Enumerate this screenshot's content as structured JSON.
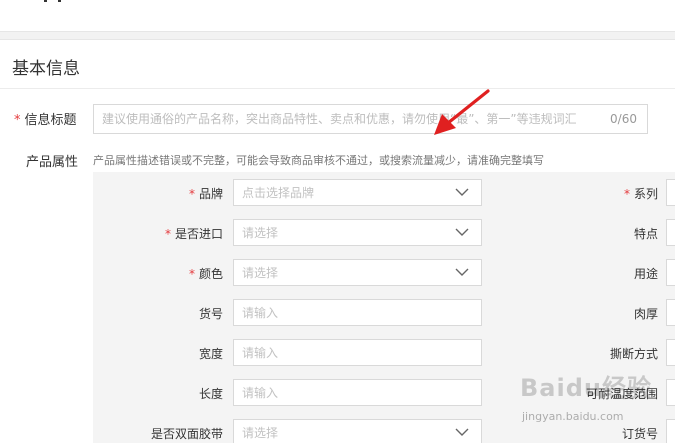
{
  "section": {
    "title": "基本信息"
  },
  "info_title": {
    "required_mark": "*",
    "label": "信息标题",
    "placeholder": "建议使用通俗的产品名称，突出商品特性、卖点和优惠，请勿使用“最”、第一”等违规词汇",
    "counter": "0/60"
  },
  "product_attributes": {
    "label": "产品属性",
    "hint": "产品属性描述错误或不完整，可能会导致商品审核不通过，或搜索流量减少，请准确完整填写",
    "left_fields": [
      {
        "label": "品牌",
        "required": true,
        "placeholder": "点击选择品牌",
        "type": "select"
      },
      {
        "label": "是否进口",
        "required": true,
        "placeholder": "请选择",
        "type": "select"
      },
      {
        "label": "颜色",
        "required": true,
        "placeholder": "请选择",
        "type": "select"
      },
      {
        "label": "货号",
        "required": false,
        "placeholder": "请输入",
        "type": "input"
      },
      {
        "label": "宽度",
        "required": false,
        "placeholder": "请输入",
        "type": "input"
      },
      {
        "label": "长度",
        "required": false,
        "placeholder": "请输入",
        "type": "input"
      },
      {
        "label": "是否双面胶带",
        "required": false,
        "placeholder": "请选择",
        "type": "select"
      }
    ],
    "right_fields": [
      {
        "label": "系列",
        "required": true
      },
      {
        "label": "特点",
        "required": false
      },
      {
        "label": "用途",
        "required": false
      },
      {
        "label": "肉厚",
        "required": false
      },
      {
        "label": "撕断方式",
        "required": false
      },
      {
        "label": "可耐温度范围",
        "required": false
      },
      {
        "label": "订货号",
        "required": false
      }
    ]
  },
  "watermark": {
    "text": "Baidu经验",
    "sub": "jingyan.baidu.com"
  },
  "icons": {
    "dropdown": "chevron-down-icon",
    "annotation": "red-arrow-icon"
  },
  "colors": {
    "required": "#e4393c",
    "arrow": "#e02020",
    "panel": "#f4f4f4",
    "border": "#d9d9d9"
  }
}
